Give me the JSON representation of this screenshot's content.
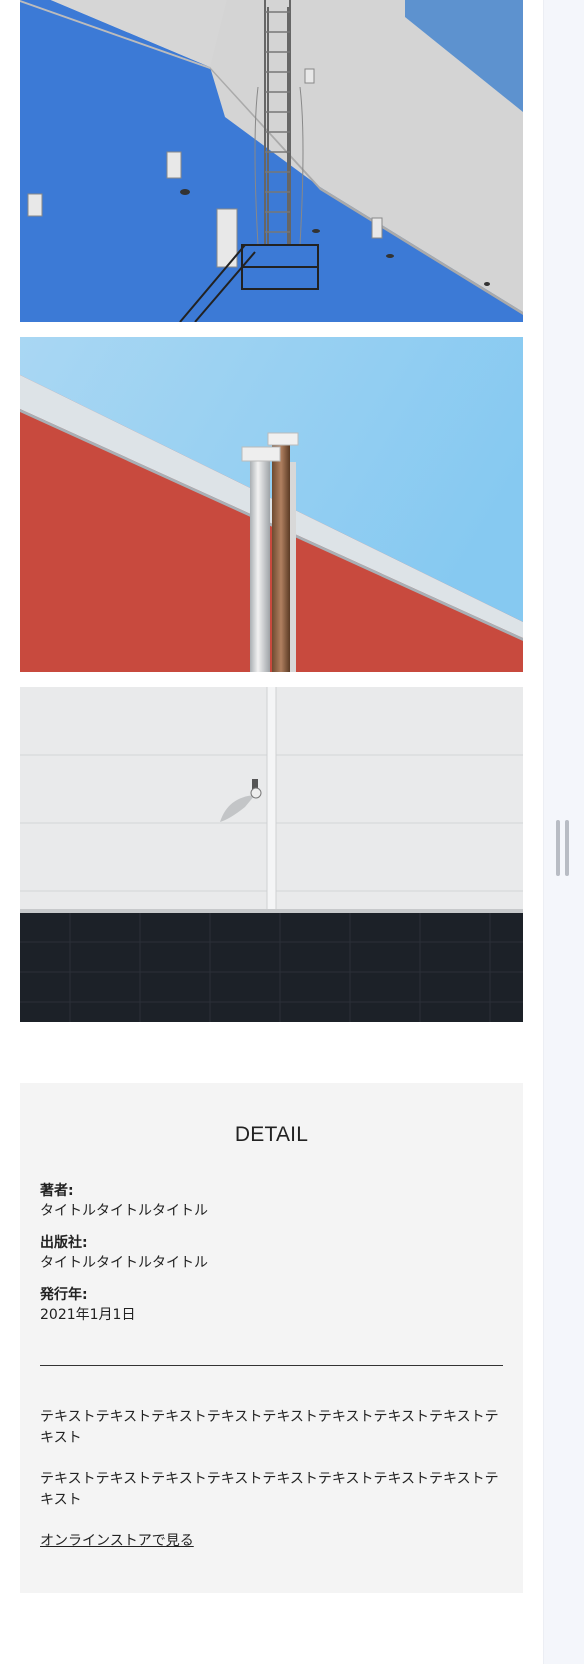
{
  "gallery": {
    "images": [
      {
        "alt": "blue-and-gray-warehouse-wall-with-ladder"
      },
      {
        "alt": "red-wall-with-metal-pipes-under-blue-sky"
      },
      {
        "alt": "white-wall-with-security-camera-over-dark-panels"
      }
    ]
  },
  "detail": {
    "title": "DETAIL",
    "author_label": "著者:",
    "author_value": "タイトルタイトルタイトル",
    "publisher_label": "出版社:",
    "publisher_value": "タイトルタイトルタイトル",
    "year_label": "発行年:",
    "year_value": "2021年1月1日",
    "paragraph_1": "テキストテキストテキストテキストテキストテキストテキストテキストテキスト",
    "paragraph_2": "テキストテキストテキストテキストテキストテキストテキストテキストテキスト",
    "store_link": "オンラインストアで見る"
  },
  "colors": {
    "panel_background": "#f4f4f4",
    "wall_blue": "#3b7bd8",
    "wall_red": "#c8473c",
    "sky_blue": "#8fcdf2",
    "text": "#222222"
  }
}
